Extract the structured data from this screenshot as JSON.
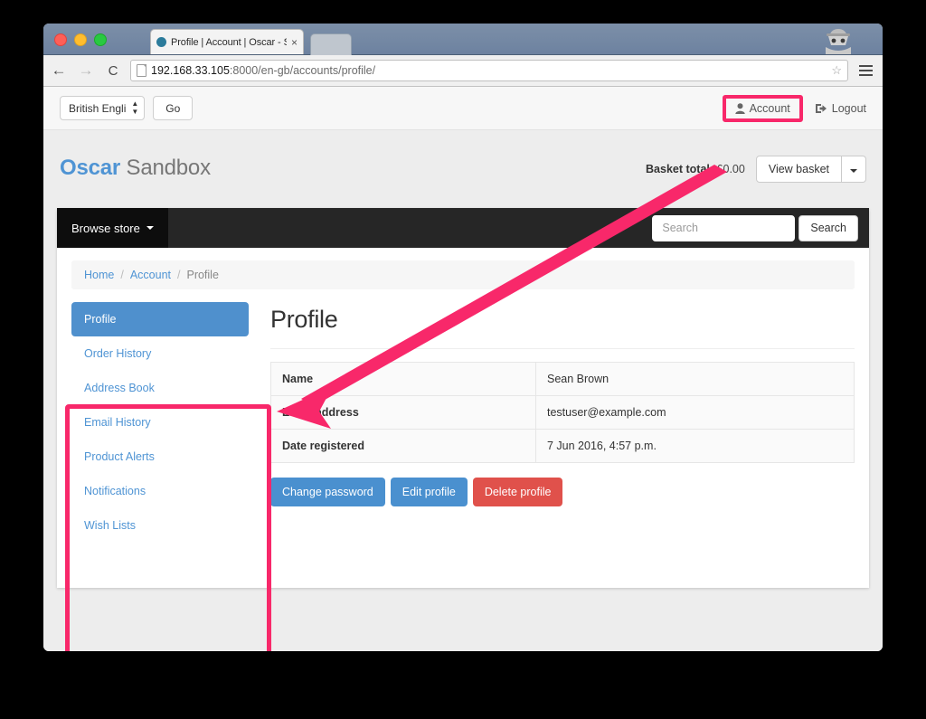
{
  "browser": {
    "tab_title": "Profile | Account | Oscar - S",
    "url_host": "192.168.33.105",
    "url_rest": ":8000/en-gb/accounts/profile/",
    "back_icon": "back-arrow-icon",
    "forward_icon": "forward-arrow-icon",
    "reload_icon": "reload-icon",
    "bookmark_icon": "star-icon",
    "menu_icon": "hamburger-menu-icon",
    "incognito_icon": "incognito-icon",
    "close_tab_icon": "×"
  },
  "utilbar": {
    "language_value": "British Engli",
    "go_label": "Go",
    "account_label": "Account",
    "account_icon": "user-icon",
    "logout_label": "Logout",
    "logout_icon": "sign-out-icon"
  },
  "header": {
    "brand_primary": "Oscar",
    "brand_secondary": "Sandbox",
    "basket_label": "Basket total:",
    "basket_amount": "£0.00",
    "view_basket_label": "View basket",
    "basket_caret_icon": "chevron-down-icon"
  },
  "navbar": {
    "browse_label": "Browse store",
    "browse_caret_icon": "caret-down-icon",
    "search_placeholder": "Search",
    "search_value": "",
    "search_button_label": "Search"
  },
  "breadcrumb": {
    "items": [
      {
        "label": "Home",
        "active": false
      },
      {
        "label": "Account",
        "active": false
      },
      {
        "label": "Profile",
        "active": true
      }
    ],
    "separator": "/"
  },
  "sidebar": {
    "items": [
      {
        "label": "Profile",
        "active": true
      },
      {
        "label": "Order History",
        "active": false
      },
      {
        "label": "Address Book",
        "active": false
      },
      {
        "label": "Email History",
        "active": false
      },
      {
        "label": "Product Alerts",
        "active": false
      },
      {
        "label": "Notifications",
        "active": false
      },
      {
        "label": "Wish Lists",
        "active": false
      }
    ]
  },
  "main": {
    "title": "Profile",
    "table": {
      "rows": [
        {
          "key": "Name",
          "value": "Sean Brown"
        },
        {
          "key": "Email address",
          "value": "testuser@example.com"
        },
        {
          "key": "Date registered",
          "value": "7 Jun 2016, 4:57 p.m."
        }
      ]
    },
    "actions": [
      {
        "label": "Change password",
        "style": "primary"
      },
      {
        "label": "Edit profile",
        "style": "primary"
      },
      {
        "label": "Delete profile",
        "style": "danger"
      }
    ]
  },
  "annotations": {
    "highlight_color": "#f8286a",
    "arrow_from": "account-link",
    "arrow_to": "account-sidebar-menu"
  }
}
